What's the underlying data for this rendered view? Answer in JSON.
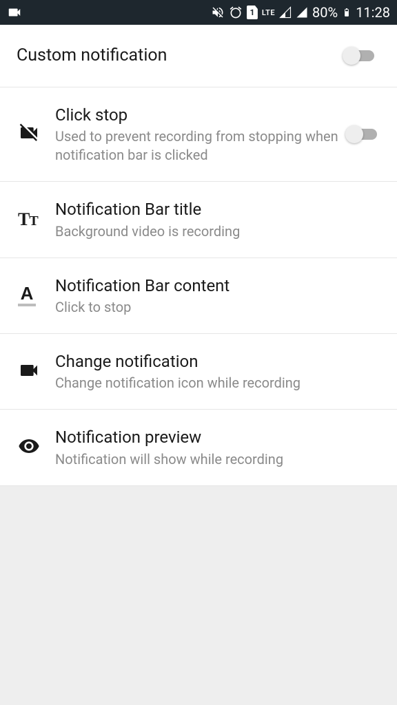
{
  "status": {
    "sim": "1",
    "network": "LTE",
    "battery": "80%",
    "time": "11:28"
  },
  "rows": {
    "custom": {
      "title": "Custom notification"
    },
    "clickstop": {
      "title": "Click stop",
      "subtitle": "Used to prevent recording from stopping when notification bar is clicked"
    },
    "bartitle": {
      "title": "Notification Bar title",
      "subtitle": "Background video is recording"
    },
    "barcontent": {
      "title": "Notification Bar content",
      "subtitle": "Click to stop"
    },
    "change": {
      "title": "Change notification",
      "subtitle": "Change notification icon while recording"
    },
    "preview": {
      "title": "Notification preview",
      "subtitle": "Notification will show while recording"
    }
  }
}
